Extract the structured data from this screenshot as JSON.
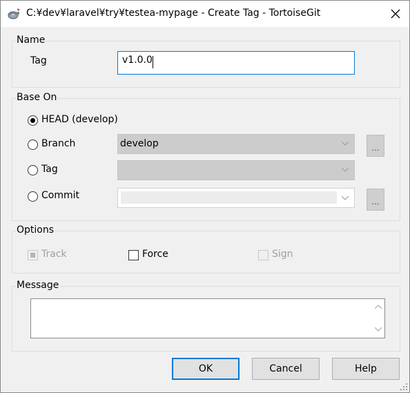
{
  "window": {
    "title": "C:¥dev¥laravel¥try¥testea-mypage - Create Tag - TortoiseGit"
  },
  "name_group": {
    "legend": "Name",
    "tag_label": "Tag",
    "tag_value": "v1.0.0"
  },
  "base_on_group": {
    "legend": "Base On",
    "head_label": "HEAD (develop)",
    "branch_label": "Branch",
    "branch_value": "develop",
    "tag_label": "Tag",
    "tag_value": "",
    "commit_label": "Commit",
    "browse_label": "...",
    "selected": "HEAD (develop)"
  },
  "options_group": {
    "legend": "Options",
    "track_label": "Track",
    "force_label": "Force",
    "sign_label": "Sign"
  },
  "message_group": {
    "legend": "Message",
    "value": ""
  },
  "buttons": {
    "ok": "OK",
    "cancel": "Cancel",
    "help": "Help"
  },
  "colors": {
    "accent": "#0078d7",
    "disabled_field": "#cccccc",
    "window_bg": "#f0f0f0"
  }
}
